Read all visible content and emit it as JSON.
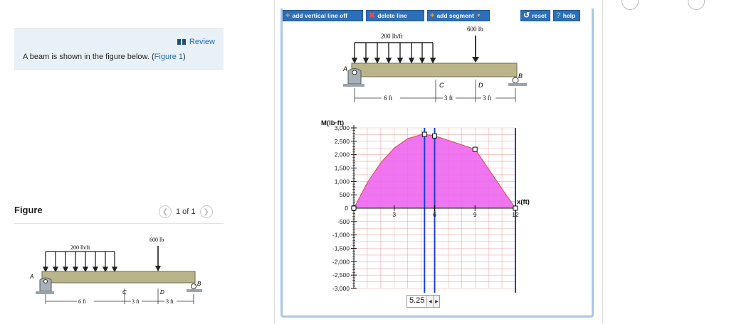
{
  "review": {
    "label": "Review"
  },
  "intro": {
    "text": "A beam is shown in the figure below. (",
    "link": "Figure 1",
    "tail": ")"
  },
  "figure": {
    "heading": "Figure",
    "pager": "1 of 1",
    "prev_icon": "chevron-left-icon",
    "next_icon": "chevron-right-icon"
  },
  "beam_figure": {
    "load_dist": "200 lb/ft",
    "load_point": "600 lb",
    "support_a": "A",
    "support_b": "B",
    "point_c": "C",
    "point_d": "D",
    "dim_1": "6 ft",
    "dim_2": "3 ft",
    "dim_3": "3 ft"
  },
  "toolbar": {
    "add_vertical": "add vertical line off",
    "delete_line": "delete line",
    "add_segment": "add segment",
    "reset": "reset",
    "help": "help"
  },
  "colors": {
    "accent": "#2d6fb8",
    "fill": "#ee66ee",
    "curve": "#d94a4a",
    "vline": "#1b3fcf",
    "grid": "#f2aaaa"
  },
  "chart_data": {
    "type": "area",
    "ylabel": "M(lb·ft)",
    "xlabel": "x(ft)",
    "ylim": [
      -3000,
      3000
    ],
    "xlim": [
      0,
      12
    ],
    "y_ticks": [
      "3,000",
      "2,500",
      "2,000",
      "1,500",
      "1,000",
      "500",
      "0",
      "-500",
      "-1,000",
      "-1,500",
      "-2,000",
      "-2,500",
      "-3,000"
    ],
    "y_tick_values": [
      3000,
      2500,
      2000,
      1500,
      1000,
      500,
      0,
      -500,
      -1000,
      -1500,
      -2000,
      -2500,
      -3000
    ],
    "x_ticks": [
      "3",
      "6",
      "9",
      "12"
    ],
    "x_tick_values": [
      3,
      6,
      9,
      12
    ],
    "curve": [
      {
        "x": 0,
        "y": 0
      },
      {
        "x": 1,
        "y": 950
      },
      {
        "x": 2,
        "y": 1700
      },
      {
        "x": 3,
        "y": 2250
      },
      {
        "x": 4,
        "y": 2600
      },
      {
        "x": 5,
        "y": 2750
      },
      {
        "x": 5.25,
        "y": 2760
      },
      {
        "x": 6,
        "y": 2700
      },
      {
        "x": 7,
        "y": 2540
      },
      {
        "x": 8,
        "y": 2370
      },
      {
        "x": 9,
        "y": 2200
      },
      {
        "x": 10,
        "y": 1470
      },
      {
        "x": 11,
        "y": 730
      },
      {
        "x": 12,
        "y": 0
      }
    ],
    "handles": [
      {
        "x": 5.25,
        "y": 2760
      },
      {
        "x": 6,
        "y": 2700
      },
      {
        "x": 9,
        "y": 2200
      },
      {
        "x": 0,
        "y": 0
      },
      {
        "x": 12,
        "y": 0
      }
    ],
    "vertical_lines": [
      5.25,
      6,
      12
    ],
    "selected_x": "5.25"
  }
}
